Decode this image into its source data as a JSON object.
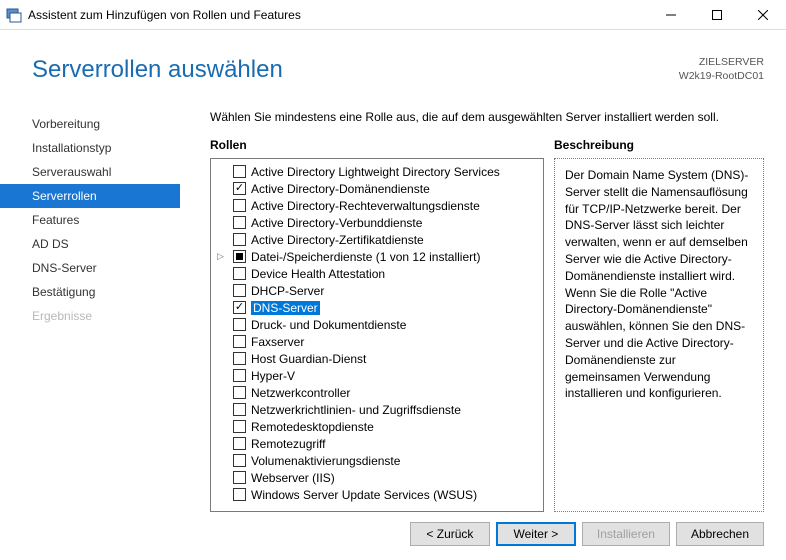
{
  "titlebar": {
    "text": "Assistent zum Hinzufügen von Rollen und Features"
  },
  "header": {
    "title": "Serverrollen auswählen",
    "target_label": "ZIELSERVER",
    "target_server": "W2k19-RootDC01"
  },
  "sidebar": {
    "items": [
      {
        "label": "Vorbereitung",
        "state": "normal"
      },
      {
        "label": "Installationstyp",
        "state": "normal"
      },
      {
        "label": "Serverauswahl",
        "state": "normal"
      },
      {
        "label": "Serverrollen",
        "state": "active"
      },
      {
        "label": "Features",
        "state": "normal"
      },
      {
        "label": "AD DS",
        "state": "normal"
      },
      {
        "label": "DNS-Server",
        "state": "normal"
      },
      {
        "label": "Bestätigung",
        "state": "normal"
      },
      {
        "label": "Ergebnisse",
        "state": "disabled"
      }
    ]
  },
  "main": {
    "instruction": "Wählen Sie mindestens eine Rolle aus, die auf dem ausgewählten Server installiert werden soll.",
    "roles_label": "Rollen",
    "desc_label": "Beschreibung",
    "roles": [
      {
        "label": "Active Directory Lightweight Directory Services",
        "checked": false
      },
      {
        "label": "Active Directory-Domänendienste",
        "checked": true
      },
      {
        "label": "Active Directory-Rechteverwaltungsdienste",
        "checked": false
      },
      {
        "label": "Active Directory-Verbunddienste",
        "checked": false
      },
      {
        "label": "Active Directory-Zertifikatdienste",
        "checked": false
      },
      {
        "label": "Datei-/Speicherdienste (1 von 12 installiert)",
        "checked": "partial",
        "expandable": true
      },
      {
        "label": "Device Health Attestation",
        "checked": false
      },
      {
        "label": "DHCP-Server",
        "checked": false
      },
      {
        "label": "DNS-Server",
        "checked": true,
        "selected": true
      },
      {
        "label": "Druck- und Dokumentdienste",
        "checked": false
      },
      {
        "label": "Faxserver",
        "checked": false
      },
      {
        "label": "Host Guardian-Dienst",
        "checked": false
      },
      {
        "label": "Hyper-V",
        "checked": false
      },
      {
        "label": "Netzwerkcontroller",
        "checked": false
      },
      {
        "label": "Netzwerkrichtlinien- und Zugriffsdienste",
        "checked": false
      },
      {
        "label": "Remotedesktopdienste",
        "checked": false
      },
      {
        "label": "Remotezugriff",
        "checked": false
      },
      {
        "label": "Volumenaktivierungsdienste",
        "checked": false
      },
      {
        "label": "Webserver (IIS)",
        "checked": false
      },
      {
        "label": "Windows Server Update Services (WSUS)",
        "checked": false
      }
    ],
    "description": "Der Domain Name System (DNS)-Server stellt die Namensauflösung für TCP/IP-Netzwerke bereit. Der DNS-Server lässt sich leichter verwalten, wenn er auf demselben Server wie die Active Directory-Domänendienste installiert wird. Wenn Sie die Rolle \"Active Directory-Domänendienste\" auswählen, können Sie den DNS-Server und die Active Directory-Domänendienste zur gemeinsamen Verwendung installieren und konfigurieren."
  },
  "footer": {
    "back": "< Zurück",
    "next": "Weiter >",
    "install": "Installieren",
    "cancel": "Abbrechen"
  }
}
